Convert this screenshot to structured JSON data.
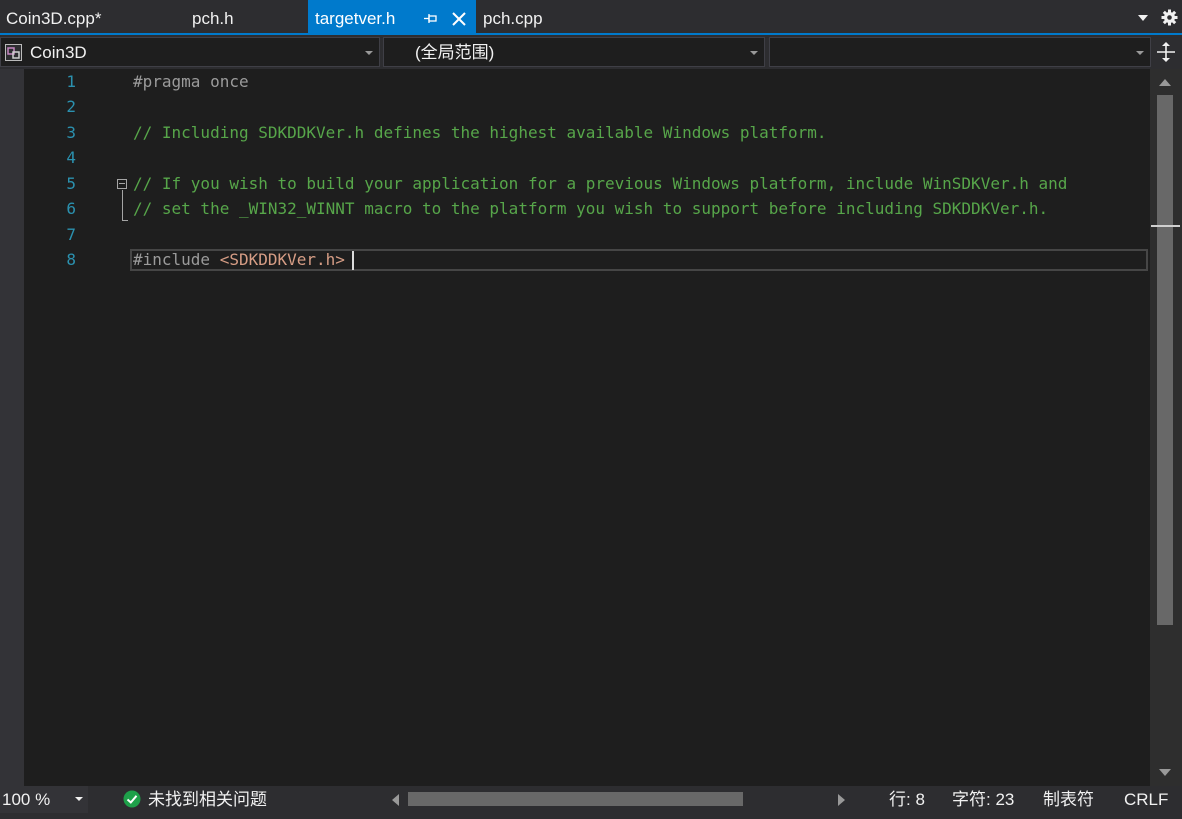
{
  "tabs": [
    {
      "label": "Coin3D.cpp*",
      "active": false
    },
    {
      "label": "pch.h",
      "active": false
    },
    {
      "label": "targetver.h",
      "active": true
    },
    {
      "label": "pch.cpp",
      "active": false
    }
  ],
  "tab_icons": {
    "pin": "pin-icon",
    "close": "close-icon",
    "dropdown": "tab-list-dropdown-icon",
    "settings": "gear-icon"
  },
  "navbar": {
    "project": "Coin3D",
    "scope": "(全局范围)",
    "member": ""
  },
  "editor": {
    "line_numbers": [
      "1",
      "2",
      "3",
      "4",
      "5",
      "6",
      "7",
      "8"
    ],
    "lines": {
      "l1": "#pragma once",
      "l3": "// Including SDKDDKVer.h defines the highest available Windows platform.",
      "l5": "// If you wish to build your application for a previous Windows platform, include WinSDKVer.h and",
      "l6": "// set the _WIN32_WINNT macro to the platform you wish to support before including SDKDDKVer.h.",
      "l8_directive": "#include ",
      "l8_header": "<SDKDDKVer.h>"
    }
  },
  "colors": {
    "accent": "#007acc",
    "comment": "#57a64a",
    "preprocessor": "#9b9b9b",
    "include_string": "#d69d85",
    "line_number": "#2b91af"
  },
  "statusbar": {
    "zoom": "100 %",
    "issues": "未找到相关问题",
    "line": "行: 8",
    "char": "字符: 23",
    "indent": "制表符",
    "line_ending": "CRLF"
  }
}
